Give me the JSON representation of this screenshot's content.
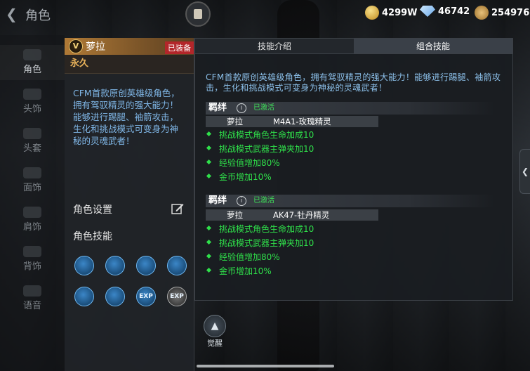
{
  "header": {
    "page_title": "角色",
    "currencies": [
      {
        "icon": "gold-coin-icon",
        "value": "4299W"
      },
      {
        "icon": "diamond-icon",
        "value": "46742"
      },
      {
        "icon": "medal-icon",
        "value": "254976"
      }
    ]
  },
  "leftnav": {
    "items": [
      {
        "label": "角色",
        "active": true
      },
      {
        "label": "头饰"
      },
      {
        "label": "头套"
      },
      {
        "label": "面饰"
      },
      {
        "label": "肩饰"
      },
      {
        "label": "背饰"
      },
      {
        "label": "语音"
      }
    ]
  },
  "character": {
    "badge": "V",
    "name": "萝拉",
    "equipped_label": "已装备",
    "duration": "永久",
    "description": "CFM首款原创英雄级角色，拥有驾驭精灵的强大能力！能够进行踢腿、袖箭攻击，生化和挑战模式可变身为神秘的灵魂武者！",
    "settings_label": "角色设置",
    "skills_label": "角色技能",
    "skill_icons": [
      {
        "name": "leg-kick-skill-icon",
        "text": ""
      },
      {
        "name": "sleeve-arrow-skill-icon",
        "text": ""
      },
      {
        "name": "spirit-summon-skill-icon",
        "text": ""
      },
      {
        "name": "soul-warrior-skill-icon",
        "text": ""
      },
      {
        "name": "bio-mode-skill-icon",
        "text": ""
      },
      {
        "name": "disabled-weapon-skill-icon",
        "text": ""
      },
      {
        "name": "exp-boost-skill-icon",
        "text": "EXP"
      },
      {
        "name": "exp-plus-skill-icon",
        "text": "EXP"
      }
    ]
  },
  "info": {
    "tabs": [
      {
        "label": "技能介绍",
        "active": false
      },
      {
        "label": "组合技能",
        "active": true
      }
    ],
    "intro": "CFM首款原创英雄级角色，拥有驾驭精灵的强大能力！能够进行踢腿、袖箭攻击，生化和挑战模式可变身为神秘的灵魂武者！",
    "bonds": [
      {
        "title": "羁绊",
        "status": "已激活",
        "character": "萝拉",
        "weapon": "M4A1-玫瑰精灵",
        "bonuses": [
          "挑战模式角色生命加成10",
          "挑战模式武器主弹夹加10",
          "经验值增加80%",
          "金币增加10%"
        ]
      },
      {
        "title": "羁绊",
        "status": "已激活",
        "character": "萝拉",
        "weapon": "AK47-牡丹精灵",
        "bonuses": [
          "挑战模式角色生命加成10",
          "挑战模式武器主弹夹加10",
          "经验值增加80%",
          "金币增加10%"
        ]
      }
    ]
  },
  "awaken_label": "觉醒",
  "colors": {
    "accent_gold": "#e8b25a",
    "bonus_green": "#2fe04a",
    "desc_blue": "#8cc0ea",
    "equipped_red": "#b3262a"
  }
}
